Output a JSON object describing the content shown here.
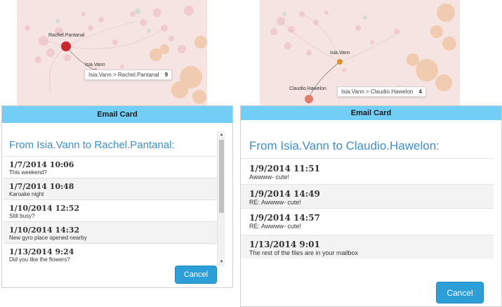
{
  "left_panel": {
    "graph": {
      "nodes": [
        "Rachel.Pantanal",
        "Isia.Vann"
      ],
      "tooltip": {
        "path": "Isia.Vann > Rachel.Pantanal",
        "count": "9"
      }
    },
    "card": {
      "header": "Email Card",
      "title": "From Isia.Vann to Rachel.Pantanal:",
      "messages": [
        {
          "date": "1/7/2014 10:06",
          "subject": "This weekend?"
        },
        {
          "date": "1/7/2014 10:48",
          "subject": "Karoake night"
        },
        {
          "date": "1/10/2014 12:52",
          "subject": "Still busy?"
        },
        {
          "date": "1/10/2014 14:32",
          "subject": "New gyro place opened nearby"
        },
        {
          "date": "1/13/2014 9:24",
          "subject": "Did you like the flowers?"
        }
      ],
      "cancel_label": "Cancel"
    }
  },
  "right_panel": {
    "graph": {
      "nodes": [
        "Isia.Vann",
        "Claudio.Hawelon"
      ],
      "tooltip": {
        "path": "Isia.Vann > Claudio.Hawelon",
        "count": "4"
      }
    },
    "card": {
      "header": "Email Card",
      "title": "From Isia.Vann to Claudio.Hawelon:",
      "messages": [
        {
          "date": "1/9/2014 11:51",
          "subject": "Awwww- cute!"
        },
        {
          "date": "1/9/2014 14:49",
          "subject": "RE: Awwww- cute!"
        },
        {
          "date": "1/9/2014 14:57",
          "subject": "RE: Awwww- cute!"
        },
        {
          "date": "1/13/2014 9:01",
          "subject": "The rest of the files are in your mailbox"
        }
      ],
      "cancel_label": "Cancel"
    }
  },
  "colors": {
    "header_bg": "#73cef5",
    "title_text": "#3d8fc9",
    "button_bg": "#2d9fd8",
    "graph_bg": "#f6e4e3",
    "selected_node_left": "#c8282c",
    "selected_node_right": "#d89228",
    "target_node_right": "#e07a6a"
  }
}
